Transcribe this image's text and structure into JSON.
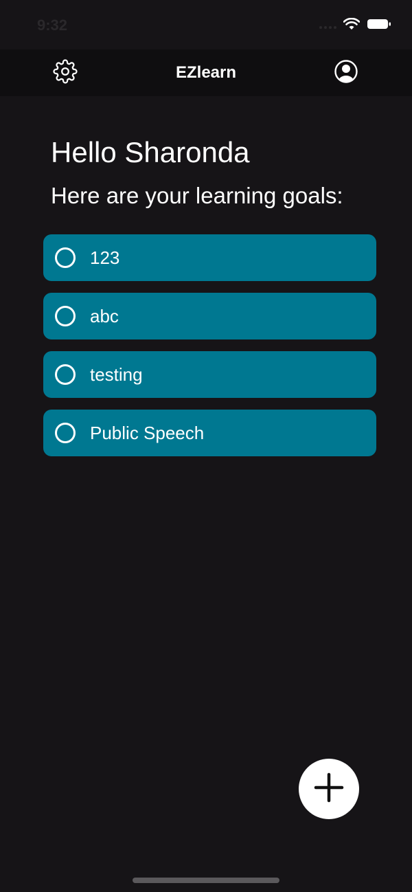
{
  "status_bar": {
    "time": "9:32",
    "icons": [
      "signal-icon",
      "wifi-icon",
      "battery-icon"
    ]
  },
  "nav": {
    "title": "EZlearn",
    "left_icon": "gear-icon",
    "right_icon": "user-circle-icon"
  },
  "main": {
    "greeting": "Hello Sharonda",
    "subtitle": "Here are your learning goals:",
    "goals": [
      {
        "label": "123",
        "checked": false
      },
      {
        "label": "abc",
        "checked": false
      },
      {
        "label": "testing",
        "checked": false
      },
      {
        "label": "Public Speech",
        "checked": false
      }
    ]
  },
  "fab": {
    "icon": "plus-icon"
  },
  "colors": {
    "background": "#161417",
    "nav_background": "#0f0e10",
    "goal_background": "#007891",
    "fab_background": "#ffffff"
  }
}
